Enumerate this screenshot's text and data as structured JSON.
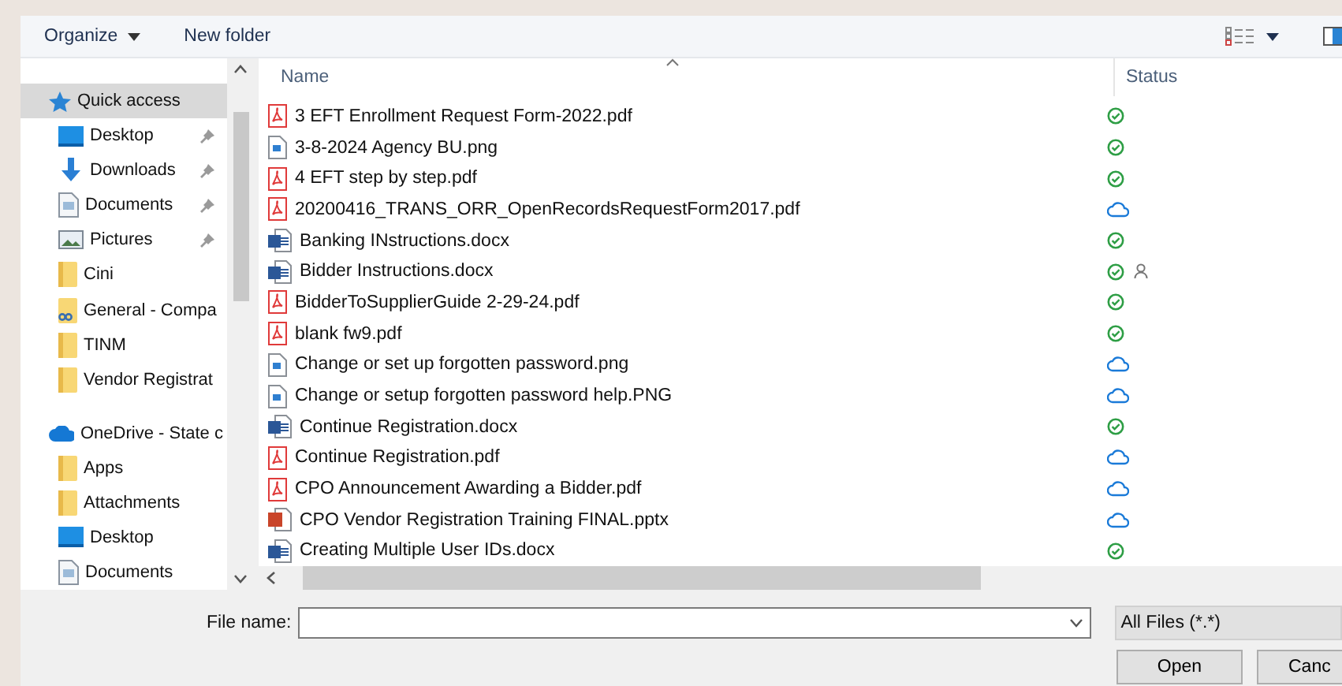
{
  "toolbar": {
    "organize": "Organize",
    "new_folder": "New folder"
  },
  "nav": [
    {
      "label": "Quick access",
      "kind": "star",
      "pinned": false,
      "selected": true
    },
    {
      "label": "Desktop",
      "kind": "desktop",
      "pinned": true,
      "selected": false
    },
    {
      "label": "Downloads",
      "kind": "download",
      "pinned": true,
      "selected": false
    },
    {
      "label": "Documents",
      "kind": "document",
      "pinned": true,
      "selected": false
    },
    {
      "label": "Pictures",
      "kind": "pictures",
      "pinned": true,
      "selected": false
    },
    {
      "label": "Cini",
      "kind": "folder",
      "pinned": false,
      "selected": false
    },
    {
      "label": "General - Compa",
      "kind": "shared-folder",
      "pinned": false,
      "selected": false
    },
    {
      "label": "TINM",
      "kind": "folder",
      "pinned": false,
      "selected": false
    },
    {
      "label": "Vendor Registrat",
      "kind": "folder",
      "pinned": false,
      "selected": false
    },
    {
      "label": "OneDrive - State c",
      "kind": "cloud",
      "pinned": false,
      "selected": false
    },
    {
      "label": "Apps",
      "kind": "folder",
      "pinned": false,
      "selected": false
    },
    {
      "label": "Attachments",
      "kind": "folder",
      "pinned": false,
      "selected": false
    },
    {
      "label": "Desktop",
      "kind": "desktop",
      "pinned": false,
      "selected": false
    },
    {
      "label": "Documents",
      "kind": "document",
      "pinned": false,
      "selected": false
    }
  ],
  "table": {
    "columns": [
      "Name",
      "Status"
    ],
    "rows": [
      {
        "name": "3 EFT Enrollment Request Form-2022.pdf",
        "kind": "pdf",
        "synced": true,
        "shared": false
      },
      {
        "name": "3-8-2024 Agency BU.png",
        "kind": "image",
        "synced": true,
        "shared": false
      },
      {
        "name": "4 EFT step by step.pdf",
        "kind": "pdf",
        "synced": true,
        "shared": false
      },
      {
        "name": "20200416_TRANS_ORR_OpenRecordsRequestForm2017.pdf",
        "kind": "pdf",
        "synced": false,
        "shared": false
      },
      {
        "name": "Banking INstructions.docx",
        "kind": "word",
        "synced": true,
        "shared": false
      },
      {
        "name": "Bidder Instructions.docx",
        "kind": "word",
        "synced": true,
        "shared": true
      },
      {
        "name": "BidderToSupplierGuide 2-29-24.pdf",
        "kind": "pdf",
        "synced": true,
        "shared": false
      },
      {
        "name": "blank fw9.pdf",
        "kind": "pdf",
        "synced": true,
        "shared": false
      },
      {
        "name": "Change or set up forgotten password.png",
        "kind": "image",
        "synced": false,
        "shared": false
      },
      {
        "name": "Change or setup forgotten password help.PNG",
        "kind": "image",
        "synced": false,
        "shared": false
      },
      {
        "name": "Continue Registration.docx",
        "kind": "word",
        "synced": true,
        "shared": false
      },
      {
        "name": "Continue Registration.pdf",
        "kind": "pdf",
        "synced": false,
        "shared": false
      },
      {
        "name": "CPO Announcement Awarding a Bidder.pdf",
        "kind": "pdf",
        "synced": false,
        "shared": false
      },
      {
        "name": "CPO Vendor Registration Training FINAL.pptx",
        "kind": "powerpoint",
        "synced": false,
        "shared": false
      },
      {
        "name": "Creating Multiple User IDs.docx",
        "kind": "word",
        "synced": true,
        "shared": false
      }
    ]
  },
  "file_name": {
    "label": "File name:"
  },
  "file_type": "All Files (*.*)",
  "buttons": [
    "Open",
    "Canc"
  ]
}
